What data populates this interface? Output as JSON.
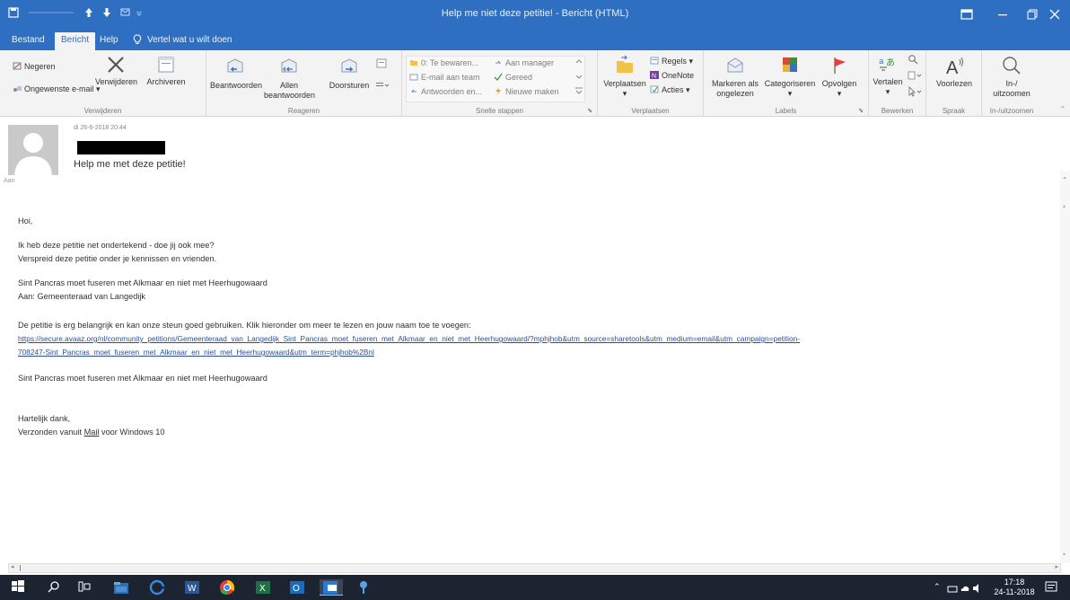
{
  "window": {
    "title": "Help me niet deze petitie!  -  Bericht (HTML)"
  },
  "tabs": [
    {
      "label": "Bestand"
    },
    {
      "label": "Bericht"
    },
    {
      "label": "Help"
    }
  ],
  "tell_me": "Vertel wat u wilt doen",
  "ribbon": {
    "groups": {
      "delete": {
        "label": "Verwijderen",
        "ignore": "Negeren",
        "junk": "Ongewenste e-mail",
        "delete_btn": "Verwijderen",
        "archive_btn": "Archiveren"
      },
      "respond": {
        "label": "Reageren",
        "reply": "Beantwoorden",
        "reply_all_1": "Allen",
        "reply_all_2": "beantwoorden",
        "forward": "Doorsturen"
      },
      "quick_steps": {
        "label": "Snelle stappen",
        "items": [
          "0: Te bewaren...",
          "E-mail aan team",
          "Antwoorden en...",
          "Aan manager",
          "Gereed",
          "Nieuwe maken"
        ]
      },
      "move": {
        "label": "Verplaatsen",
        "move_btn": "Verplaatsen",
        "rules": "Regels",
        "onenote": "OneNote",
        "actions": "Acties"
      },
      "tags": {
        "label": "Labels",
        "mark_unread_1": "Markeren als",
        "mark_unread_2": "ongelezen",
        "categorize": "Categoriseren",
        "followup": "Opvolgen"
      },
      "editing": {
        "label": "Bewerken",
        "translate": "Vertalen"
      },
      "speech": {
        "label": "Spraak",
        "read_aloud": "Voorlezen"
      },
      "zoom": {
        "label": "In-/uitzoomen",
        "zoom_1": "In-/",
        "zoom_2": "uitzoomen"
      }
    }
  },
  "message": {
    "date": "di 26-6-2018 20:44",
    "subject": "Help me met deze petitie!",
    "to_label": "Aan",
    "body": {
      "greeting": "Hoi,",
      "p1_l1": "Ik heb deze petitie net ondertekend - doe jij ook mee?",
      "p1_l2": "Verspreid deze petitie onder je kennissen en vrienden.",
      "p2_l1": "Sint Pancras moet fuseren met Alkmaar en niet met Heerhugowaard",
      "p2_l2": "Aan: Gemeenteraad van Langedijk",
      "p3_l1": "De petitie is erg belangrijk en kan onze steun goed gebruiken. Klik hieronder om meer te lezen en jouw naam toe te voegen:",
      "link_l1": "https://secure.avaaz.org/nl/community_petitions/Gemeenteraad_van_Langedijk_Sint_Pancras_moet_fuseren_met_Alkmaar_en_niet_met_Heerhugowaard/?mphjhob&utm_source=sharetools&utm_medium=email&utm_campaign=petition-",
      "link_l2": "708247-Sint_Pancras_moet_fuseren_met_Alkmaar_en_niet_met_Heerhugowaard&utm_term=phjhob%2Bnl",
      "p4": "Sint Pancras moet fuseren met Alkmaar en niet met Heerhugowaard",
      "thanks": "Hartelijk dank,",
      "sig_pre": "Verzonden vanuit ",
      "sig_link": "Mail",
      "sig_post": " voor Windows 10"
    }
  },
  "taskbar": {
    "time": "17:18",
    "date": "24-11-2018"
  },
  "colors": {
    "titlebar": "#2e6fc1",
    "ribbon": "#f3f3f3",
    "taskbar": "#1c2431",
    "link": "#2a4f96"
  }
}
